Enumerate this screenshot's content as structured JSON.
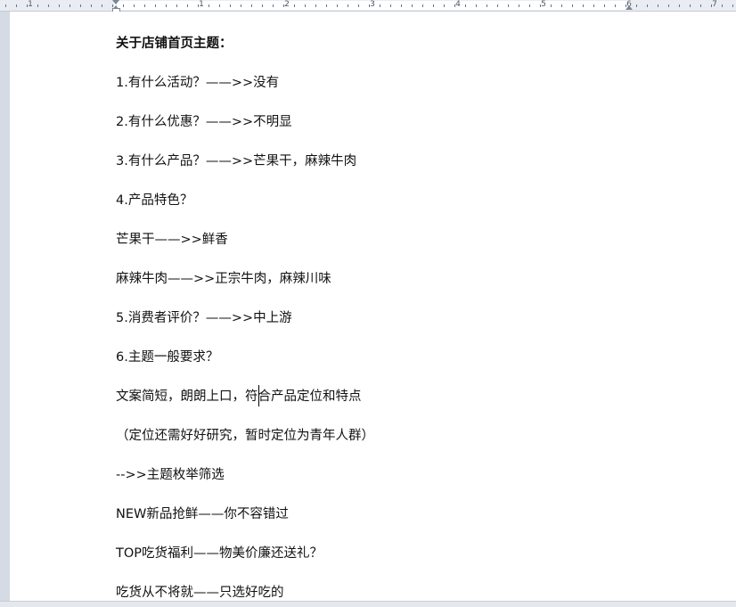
{
  "ruler": {
    "numbers": [
      "1",
      "1",
      "2",
      "3",
      "4",
      "5",
      "6",
      "7"
    ]
  },
  "document": {
    "lines": [
      "关于店铺首页主题：",
      "1.有什么活动？——>>没有",
      "2.有什么优惠？——>>不明显",
      "3.有什么产品？——>>芒果干，麻辣牛肉",
      "4.产品特色？",
      "芒果干——>>鲜香",
      "麻辣牛肉——>>正宗牛肉，麻辣川味",
      "5.消费者评价？——>>中上游",
      "6.主题一般要求？",
      "文案简短，朗朗上口，符合产品定位和特点",
      "（定位还需好好研究，暂时定位为青年人群）",
      "-->>主题枚举筛选",
      "NEW新品抢鲜——你不容错过",
      "TOP吃货福利——物美价廉还送礼？",
      "吃货从不将就——只选好吃的"
    ]
  }
}
